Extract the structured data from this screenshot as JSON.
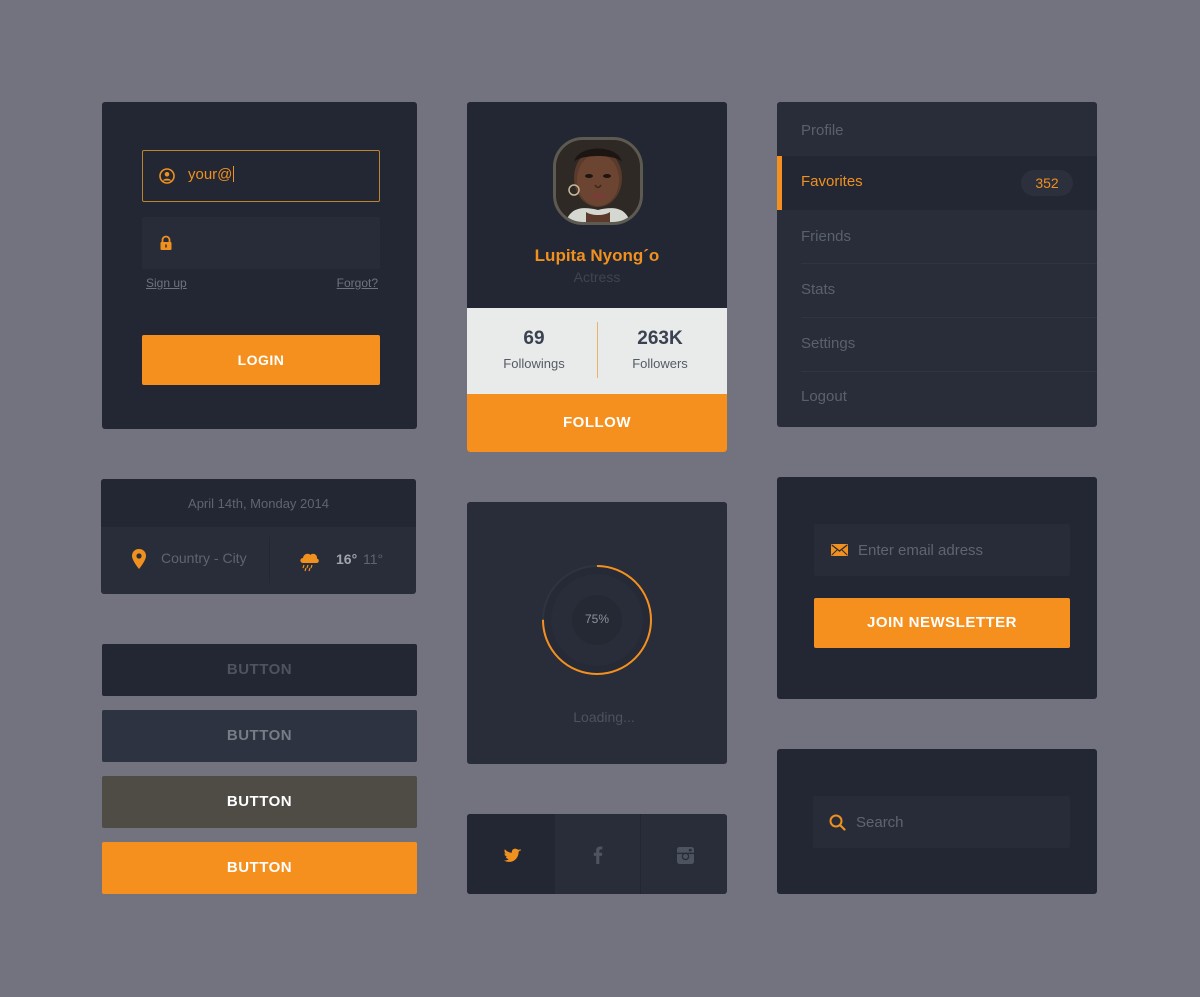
{
  "colors": {
    "accent": "#f5901f",
    "card": "#222733",
    "background": "#72737f"
  },
  "login": {
    "email_value": "your@",
    "signup_label": "Sign up",
    "forgot_label": "Forgot?",
    "login_label": "LOGIN",
    "icons": {
      "user": "user-circle-icon",
      "password": "lock-icon"
    }
  },
  "profile": {
    "name": "Lupita Nyong´o",
    "role": "Actress",
    "followings_count": "69",
    "followings_label": "Followings",
    "followers_count": "263K",
    "followers_label": "Followers",
    "follow_label": "FOLLOW"
  },
  "menu": {
    "items": [
      {
        "label": "Profile"
      },
      {
        "label": "Favorites",
        "badge": "352",
        "active": true
      },
      {
        "label": "Friends"
      },
      {
        "label": "Stats"
      },
      {
        "label": "Settings"
      },
      {
        "label": "Logout"
      }
    ]
  },
  "weather": {
    "date": "April 14th, Monday 2014",
    "location": "Country - City",
    "temp_high": "16°",
    "temp_low": "11°",
    "icons": {
      "location": "map-pin-icon",
      "weather": "rain-cloud-icon"
    }
  },
  "buttons": {
    "labels": [
      "BUTTON",
      "BUTTON",
      "BUTTON",
      "BUTTON"
    ]
  },
  "loader": {
    "percent_label": "75%",
    "progress": 0.75,
    "text": "Loading..."
  },
  "social": {
    "icons": [
      "twitter-icon",
      "facebook-icon",
      "instagram-icon"
    ],
    "active": "twitter-icon"
  },
  "newsletter": {
    "placeholder": "Enter email adress",
    "button_label": "JOIN NEWSLETTER"
  },
  "search": {
    "placeholder": "Search"
  }
}
